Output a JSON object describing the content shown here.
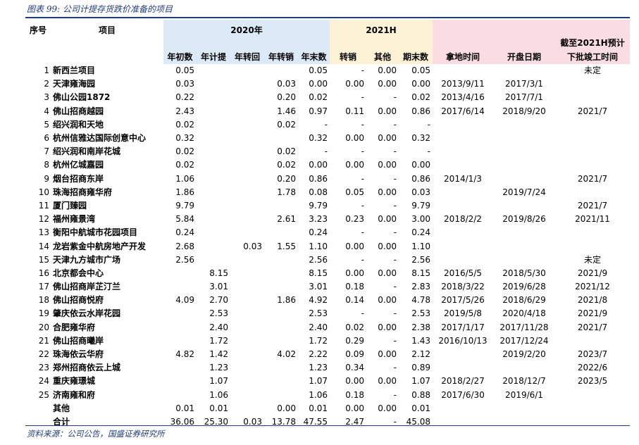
{
  "caption": "图表 99:  公司计提存货跌价准备的项目",
  "source": "资料来源：公司公告，国盛证券研究所",
  "headers": {
    "seq": "序号",
    "item": "项目",
    "group_2020": "2020年",
    "group_2021": "2021H",
    "deadline": "截至2021H预计",
    "deadline2": "下批竣工时间",
    "cols_2020": [
      "年初数",
      "年计提",
      "年转回",
      "年转销",
      "年末数"
    ],
    "cols_2021": [
      "转销",
      "其他",
      "期末数"
    ],
    "land_date": "拿地时间",
    "open_date": "开盘日期"
  },
  "rows": [
    [
      "1",
      "新西兰项目",
      "0.05",
      "",
      "",
      "",
      "0.05",
      "-",
      "0.00",
      "0.05",
      "",
      "",
      "未定"
    ],
    [
      "2",
      "天津雍海园",
      "0.03",
      "",
      "",
      "0.03",
      "0.00",
      "0.00",
      "0.00",
      "0.00",
      "2013/9/11",
      "2017/3/1",
      ""
    ],
    [
      "3",
      "佛山公园1872",
      "0.22",
      "",
      "",
      "0.20",
      "0.02",
      "-",
      "-",
      "0.02",
      "2013/4/16",
      "2017/7/1",
      ""
    ],
    [
      "4",
      "佛山招商越园",
      "2.43",
      "",
      "",
      "1.46",
      "0.97",
      "0.11",
      "0.00",
      "0.86",
      "2017/6/14",
      "2018/9/20",
      "2021/7"
    ],
    [
      "5",
      "绍兴润和天地",
      "0.02",
      "",
      "",
      "0.02",
      "-",
      "-",
      "-",
      "-",
      "",
      "",
      ""
    ],
    [
      "6",
      "杭州信雅达国际创意中心",
      "0.32",
      "",
      "",
      "",
      "0.32",
      "0.00",
      "0.00",
      "0.32",
      "",
      "",
      ""
    ],
    [
      "7",
      "绍兴润和南岸花城",
      "0.02",
      "",
      "",
      "0.02",
      "-",
      "-",
      "-",
      "-",
      "",
      "",
      ""
    ],
    [
      "8",
      "杭州亿城嘉园",
      "0.02",
      "",
      "",
      "0.02",
      "0.00",
      "0.00",
      "0.00",
      "0.00",
      "",
      "",
      ""
    ],
    [
      "9",
      "烟台招商东岸",
      "1.06",
      "",
      "",
      "0.20",
      "0.86",
      "-",
      "-",
      "0.86",
      "2014/1/3",
      "",
      "2021/7"
    ],
    [
      "10",
      "珠海招商雍华府",
      "1.86",
      "",
      "",
      "1.78",
      "0.08",
      "0.05",
      "0.00",
      "0.03",
      "",
      "2019/7/24",
      ""
    ],
    [
      "11",
      "厦门臻园",
      "9.79",
      "",
      "",
      "",
      "9.79",
      "-",
      "-",
      "9.79",
      "",
      "",
      "2021/7"
    ],
    [
      "12",
      "福州雍景湾",
      "5.84",
      "",
      "",
      "2.61",
      "3.23",
      "0.23",
      "0.00",
      "3.00",
      "2018/2/2",
      "2019/8/26",
      "2021/11"
    ],
    [
      "13",
      "衡阳中航城市花园项目",
      "0.24",
      "",
      "",
      "",
      "0.24",
      "-",
      "-",
      "0.24",
      "",
      "",
      ""
    ],
    [
      "14",
      "龙岩紫金中航房地产开发",
      "2.68",
      "",
      "0.03",
      "1.55",
      "1.10",
      "0.00",
      "0.00",
      "1.10",
      "",
      "",
      ""
    ],
    [
      "15",
      "天津九方城市广场",
      "2.56",
      "",
      "",
      "",
      "2.56",
      "-",
      "-",
      "2.56",
      "",
      "",
      "未定"
    ],
    [
      "16",
      "北京都会中心",
      "",
      "8.15",
      "",
      "",
      "8.15",
      "0.00",
      "0.00",
      "8.15",
      "2016/5/5",
      "2018/5/30",
      "2021/9"
    ],
    [
      "17",
      "佛山招商岸芷汀兰",
      "",
      "3.01",
      "",
      "",
      "3.01",
      "0.18",
      "-",
      "2.83",
      "2018/3/22",
      "2019/6/28",
      "2021/12"
    ],
    [
      "18",
      "佛山招商悦府",
      "4.09",
      "2.70",
      "",
      "1.86",
      "4.92",
      "0.14",
      "0.00",
      "4.78",
      "2017/5/26",
      "2018/6/29",
      "2021/8"
    ],
    [
      "19",
      "肇庆依云水岸花园",
      "",
      "2.53",
      "",
      "",
      "2.53",
      "-",
      "-",
      "2.53",
      "2019/5/8",
      "2020/4/18",
      "2021/9"
    ],
    [
      "20",
      "合肥雍华府",
      "",
      "2.40",
      "",
      "",
      "2.40",
      "0.02",
      "0.00",
      "2.38",
      "2017/1/17",
      "2017/11/28",
      "2021/7"
    ],
    [
      "21",
      "佛山招商曦岸",
      "",
      "1.72",
      "",
      "",
      "1.72",
      "0.29",
      "-",
      "1.43",
      "2016/10/13",
      "2017/12/24",
      ""
    ],
    [
      "22",
      "珠海依云华府",
      "4.82",
      "1.42",
      "",
      "4.02",
      "2.22",
      "0.09",
      "0.00",
      "2.12",
      "",
      "2019/2/20",
      "2023/7"
    ],
    [
      "23",
      "郑州招商依云上城",
      "",
      "1.23",
      "",
      "",
      "1.23",
      "0.34",
      "-",
      "0.89",
      "",
      "",
      "2022/6"
    ],
    [
      "24",
      "重庆雍璟城",
      "",
      "1.07",
      "",
      "",
      "1.07",
      "0.00",
      "0.00",
      "1.07",
      "2018/2/27",
      "2018/12/7",
      "2023/5"
    ],
    [
      "25",
      "济南雍和府",
      "",
      "1.06",
      "",
      "",
      "1.06",
      "0.18",
      "-",
      "0.88",
      "2017/6/30",
      "2019/6/1",
      ""
    ],
    [
      "",
      "其他",
      "0.01",
      "0.01",
      "",
      "0.00",
      "0.01",
      "0.00",
      "0.00",
      "0.01",
      "",
      "",
      ""
    ],
    [
      "",
      "合计",
      "36.06",
      "25.30",
      "0.03",
      "13.78",
      "47.55",
      "2.47",
      "-",
      "45.08",
      "",
      "",
      ""
    ]
  ]
}
